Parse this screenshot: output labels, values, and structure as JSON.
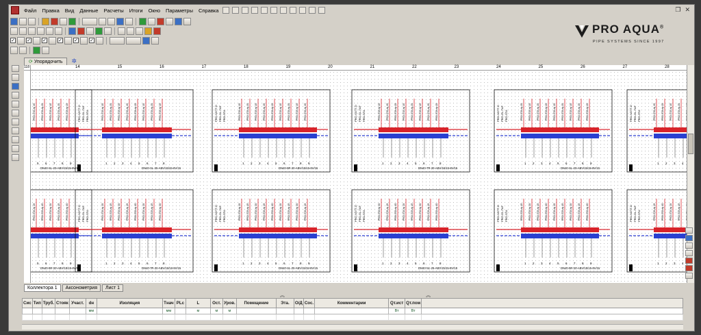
{
  "menu": [
    "Файл",
    "Правка",
    "Вид",
    "Данные",
    "Расчеты",
    "Итоги",
    "Окно",
    "Параметры",
    "Справка"
  ],
  "logo": {
    "brand": "PRO AQUA",
    "reg": "®",
    "tagline": "PIPE SYSTEMS SINCE 1997"
  },
  "tabs": {
    "active": "Упорядочить"
  },
  "ruler": {
    "corner": "118",
    "ticks": [
      "14",
      "15",
      "16",
      "17",
      "18",
      "19",
      "20",
      "21",
      "22",
      "23",
      "24",
      "25",
      "26",
      "27",
      "28"
    ]
  },
  "sheet_tabs": [
    "Коллектора 1",
    "Аксонометрия",
    "Лист 1"
  ],
  "grid": {
    "headers": [
      "Сис",
      "Тип",
      "Труб.",
      "Стояк",
      "Участ.",
      "dн",
      "Изоляция",
      "Тнач",
      "РLс",
      "L",
      "Ост.",
      "Уров.",
      "Помещение",
      "Эта.",
      "О/Д",
      "Сос.",
      "Комментарии",
      "Qт.ист",
      "Qт.пом"
    ],
    "units": [
      "",
      "",
      "",
      "",
      "",
      "мм",
      "",
      "мм",
      "",
      "м",
      "м",
      "м",
      "",
      "",
      "",
      "",
      "",
      "Вт",
      "Вт"
    ]
  },
  "drawing": {
    "labels": [
      "PRO-NOTT-D",
      "PRO-GL-TAF",
      "PRO-STA",
      "dy 15",
      "dy 20"
    ],
    "numbers": [
      "1",
      "2",
      "3",
      "4",
      "5",
      "6",
      "7",
      "8",
      "9"
    ],
    "captions": [
      "DN40-SL-20-ABV/15/15-8V/15",
      "DN40-SL-25-ABV/15/15-8V/15",
      "DN40-5R-20-ABV/15/15-8V/15",
      "DN40-7R-20-ABV/15/15-8V/15"
    ]
  },
  "colors": {
    "supply": "#d8232a",
    "return": "#2a3fd0",
    "frame": "#111111"
  }
}
